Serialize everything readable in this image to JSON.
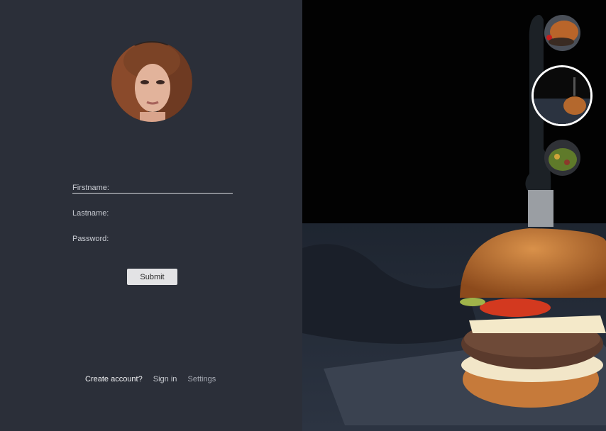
{
  "form": {
    "firstname_label": "Firstname:",
    "lastname_label": "Lastname:",
    "password_label": "Password:",
    "submit_label": "Submit"
  },
  "footer": {
    "create_account": "Create account?",
    "sign_in": "Sign in",
    "settings": "Settings"
  },
  "colors": {
    "panel_bg": "#2b2f39",
    "photo_bg": "#020202",
    "button_bg": "#e3e3e5",
    "text_light": "#c9ccd3"
  },
  "gallery": {
    "items": [
      "food-thumbnail",
      "burger-thumbnail",
      "salad-thumbnail"
    ],
    "selected_index": 1
  }
}
